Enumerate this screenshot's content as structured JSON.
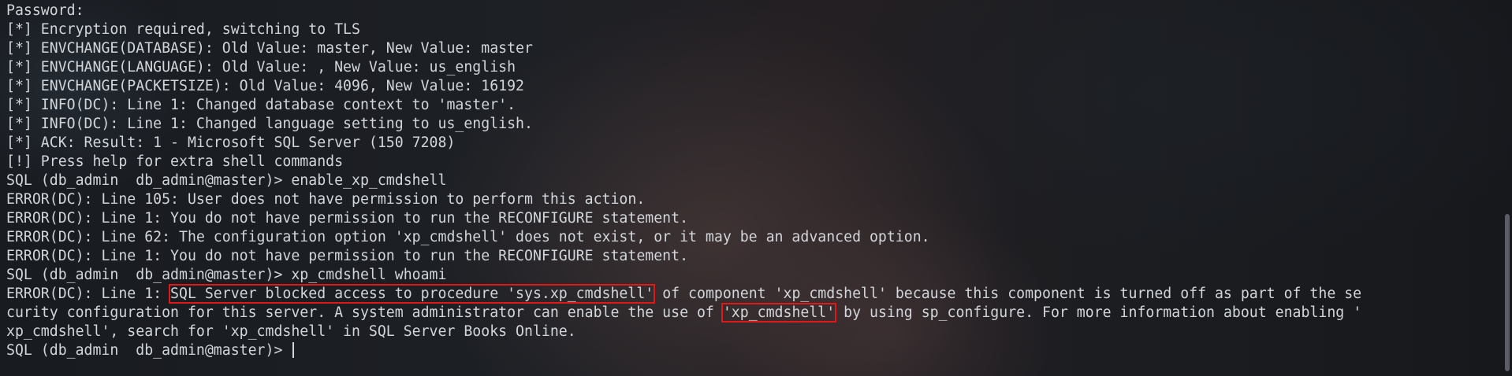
{
  "terminal": {
    "lines": {
      "l0": "Password:",
      "l1": "[*] Encryption required, switching to TLS",
      "l2": "[*] ENVCHANGE(DATABASE): Old Value: master, New Value: master",
      "l3": "[*] ENVCHANGE(LANGUAGE): Old Value: , New Value: us_english",
      "l4": "[*] ENVCHANGE(PACKETSIZE): Old Value: 4096, New Value: 16192",
      "l5": "[*] INFO(DC): Line 1: Changed database context to 'master'.",
      "l6": "[*] INFO(DC): Line 1: Changed language setting to us_english.",
      "l7": "[*] ACK: Result: 1 - Microsoft SQL Server (150 7208)",
      "l8": "[!] Press help for extra shell commands",
      "l9": "SQL (db_admin  db_admin@master)> enable_xp_cmdshell",
      "l10": "ERROR(DC): Line 105: User does not have permission to perform this action.",
      "l11": "ERROR(DC): Line 1: You do not have permission to run the RECONFIGURE statement.",
      "l12": "ERROR(DC): Line 62: The configuration option 'xp_cmdshell' does not exist, or it may be an advanced option.",
      "l13": "ERROR(DC): Line 1: You do not have permission to run the RECONFIGURE statement.",
      "l14": "SQL (db_admin  db_admin@master)> xp_cmdshell whoami",
      "l15a": "ERROR(DC): Line 1: ",
      "l15b": "SQL Server blocked access to procedure 'sys.xp_cmdshell'",
      "l15c": " of component 'xp_cmdshell' because this component is turned off as part of the se",
      "l16a": "curity configuration for this server. A system administrator can enable the use of ",
      "l16b": "'xp_cmdshell'",
      "l16c": " by using sp_configure. For more information about enabling '",
      "l17": "xp_cmdshell', search for 'xp_cmdshell' in SQL Server Books Online.",
      "prompt": "SQL (db_admin  db_admin@master)> "
    },
    "colors": {
      "text": "#d2d6da",
      "highlight_box": "#e01818",
      "background": "#1d2025"
    }
  }
}
